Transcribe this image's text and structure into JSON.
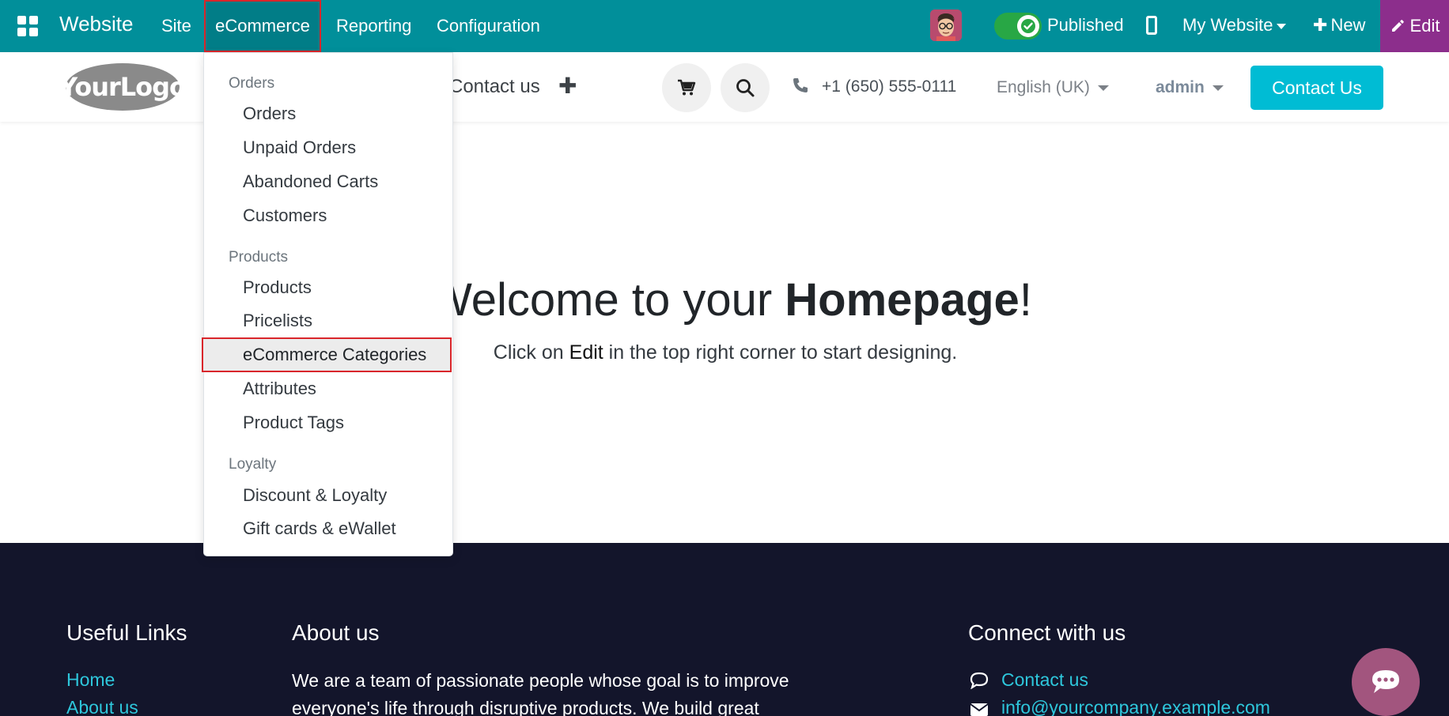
{
  "topbar": {
    "brand": "Website",
    "menu": [
      "Site",
      "eCommerce",
      "Reporting",
      "Configuration"
    ],
    "published_label": "Published",
    "website_selector": "My Website",
    "new_label": "New",
    "edit_label": "Edit",
    "colors": {
      "bar": "#018f9a",
      "edit": "#8c2e8c",
      "toggle": "#28a745"
    }
  },
  "header": {
    "logo_text": "YourLogo",
    "nav_contact": "Contact us",
    "phone": "+1 (650) 555-0111",
    "language": "English (UK)",
    "user": "admin",
    "cta": "Contact Us",
    "cta_color": "#00bcd4"
  },
  "dropdown": {
    "sections": [
      {
        "header": "Orders",
        "items": [
          "Orders",
          "Unpaid Orders",
          "Abandoned Carts",
          "Customers"
        ]
      },
      {
        "header": "Products",
        "items": [
          "Products",
          "Pricelists",
          "eCommerce Categories",
          "Attributes",
          "Product Tags"
        ]
      },
      {
        "header": "Loyalty",
        "items": [
          "Discount & Loyalty",
          "Gift cards & eWallet"
        ]
      }
    ],
    "highlighted": "eCommerce Categories"
  },
  "hero": {
    "title_pre": "Welcome to your ",
    "title_bold": "Homepage",
    "title_post": "!",
    "sub_pre": "Click on ",
    "sub_em": "Edit",
    "sub_post": " in the top right corner to start designing."
  },
  "footer": {
    "useful_links_title": "Useful Links",
    "links": [
      "Home",
      "About us"
    ],
    "about_title": "About us",
    "about_text": "We are a team of passionate people whose goal is to improve everyone's life through disruptive products. We build great",
    "connect_title": "Connect with us",
    "connect_items": [
      "Contact us",
      "info@yourcompany.example.com"
    ]
  }
}
